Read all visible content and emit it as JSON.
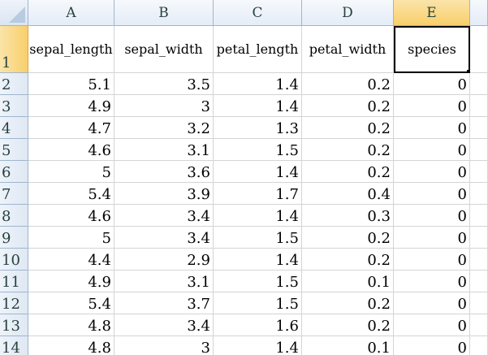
{
  "columns": [
    "A",
    "B",
    "C",
    "D",
    "E"
  ],
  "header_row": {
    "row_number": "1",
    "cells": [
      "sepal_length",
      "sepal_width",
      "petal_length",
      "petal_width",
      "species"
    ]
  },
  "rows": [
    {
      "num": "2",
      "cells": [
        "5.1",
        "3.5",
        "1.4",
        "0.2",
        "0"
      ]
    },
    {
      "num": "3",
      "cells": [
        "4.9",
        "3",
        "1.4",
        "0.2",
        "0"
      ]
    },
    {
      "num": "4",
      "cells": [
        "4.7",
        "3.2",
        "1.3",
        "0.2",
        "0"
      ]
    },
    {
      "num": "5",
      "cells": [
        "4.6",
        "3.1",
        "1.5",
        "0.2",
        "0"
      ]
    },
    {
      "num": "6",
      "cells": [
        "5",
        "3.6",
        "1.4",
        "0.2",
        "0"
      ]
    },
    {
      "num": "7",
      "cells": [
        "5.4",
        "3.9",
        "1.7",
        "0.4",
        "0"
      ]
    },
    {
      "num": "8",
      "cells": [
        "4.6",
        "3.4",
        "1.4",
        "0.3",
        "0"
      ]
    },
    {
      "num": "9",
      "cells": [
        "5",
        "3.4",
        "1.5",
        "0.2",
        "0"
      ]
    },
    {
      "num": "10",
      "cells": [
        "4.4",
        "2.9",
        "1.4",
        "0.2",
        "0"
      ]
    },
    {
      "num": "11",
      "cells": [
        "4.9",
        "3.1",
        "1.5",
        "0.1",
        "0"
      ]
    },
    {
      "num": "12",
      "cells": [
        "5.4",
        "3.7",
        "1.5",
        "0.2",
        "0"
      ]
    },
    {
      "num": "13",
      "cells": [
        "4.8",
        "3.4",
        "1.6",
        "0.2",
        "0"
      ]
    },
    {
      "num": "14",
      "cells": [
        "4.8",
        "3",
        "1.4",
        "0.1",
        "0"
      ]
    }
  ],
  "selection": {
    "active_cell": "E1",
    "selected_column": "E",
    "selected_row": "1"
  },
  "colors": {
    "selection_header": "#f8cf6b",
    "header_bg": "#e4ecf7",
    "grid_line": "#d4d4d4"
  }
}
